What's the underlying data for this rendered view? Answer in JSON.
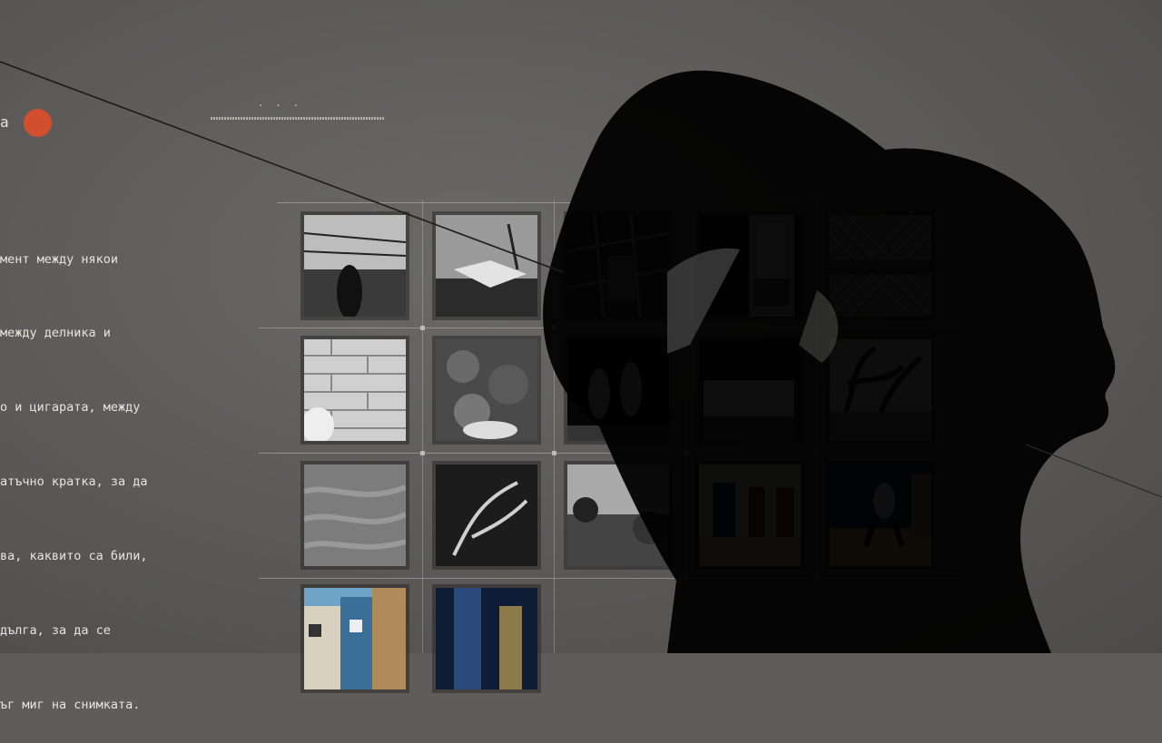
{
  "logo": {
    "fragment": "а",
    "dot_color": "#d14e2e"
  },
  "nav": {
    "dots": "· · ·"
  },
  "intro": {
    "lines": [
      "мент между някои",
      "между делника и",
      "о и цигарата, между",
      "атъчно кратка, за да",
      "ва, каквито са били,",
      "дълга, за да се",
      "ъг миг на снимката."
    ]
  },
  "gallery": {
    "photos": [
      {
        "name": "photo-fence-person",
        "tone": "bw"
      },
      {
        "name": "photo-harbor-boats",
        "tone": "bw"
      },
      {
        "name": "photo-stairs-floor",
        "tone": "bw"
      },
      {
        "name": "photo-window-doorway",
        "tone": "bw"
      },
      {
        "name": "photo-chainlink-fence",
        "tone": "bw"
      },
      {
        "name": "photo-brick-wall",
        "tone": "bw"
      },
      {
        "name": "photo-grass-feet",
        "tone": "bw"
      },
      {
        "name": "photo-children-dark",
        "tone": "bw"
      },
      {
        "name": "photo-billboard",
        "tone": "bw"
      },
      {
        "name": "photo-tree-shadows",
        "tone": "bw"
      },
      {
        "name": "photo-sand-texture",
        "tone": "bw"
      },
      {
        "name": "photo-branch-dark",
        "tone": "bw"
      },
      {
        "name": "photo-landscape-sky",
        "tone": "bw"
      },
      {
        "name": "photo-hallway-doors",
        "tone": "color"
      },
      {
        "name": "photo-skateboarder",
        "tone": "color"
      },
      {
        "name": "photo-colorful-houses",
        "tone": "color"
      },
      {
        "name": "photo-alley-blue",
        "tone": "color"
      }
    ]
  },
  "colors": {
    "background": "#5e5d5c",
    "text": "#e6e4df",
    "accent": "#d14e2e",
    "silhouette": "#000000"
  }
}
